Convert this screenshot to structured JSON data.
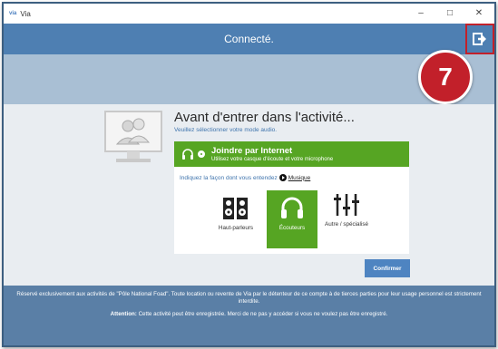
{
  "window": {
    "title": "Via",
    "app_icon": "via"
  },
  "header": {
    "status": "Connecté."
  },
  "badge": {
    "number": "7"
  },
  "main": {
    "title": "Avant d'entrer dans l'activité...",
    "subtitle": "Veuillez sélectionner votre mode audio.",
    "internet": {
      "label": "Joindre par Internet",
      "sub": "Utilisez votre casque d'écoute et votre microphone"
    },
    "hint": "Indiquez la façon dont vous entendez",
    "music_link": "Musique",
    "options": [
      {
        "label": "Haut-parleurs",
        "icon": "speaker-icon",
        "selected": false
      },
      {
        "label": "Écouteurs",
        "icon": "headphones-icon",
        "selected": true
      },
      {
        "label": "Autre / spécialisé",
        "icon": "mixer-icon",
        "selected": false
      }
    ],
    "confirm": "Confirmer"
  },
  "footer": {
    "line1": "Réservé exclusivement aux activités de \"Pôle National Foad\". Toute location ou revente de Via par le détenteur de ce compte à de tierces parties pour leur usage personnel est strictement interdite.",
    "attention_label": "Attention:",
    "attention_text": " Cette activité peut être enregistrée. Merci de ne pas y accéder si vous ne voulez pas être enregistré."
  },
  "colors": {
    "header": "#4e7fb2",
    "green": "#56a523",
    "badge": "#c2202a",
    "footer": "#5a7fa6",
    "confirm": "#4e84c1"
  }
}
